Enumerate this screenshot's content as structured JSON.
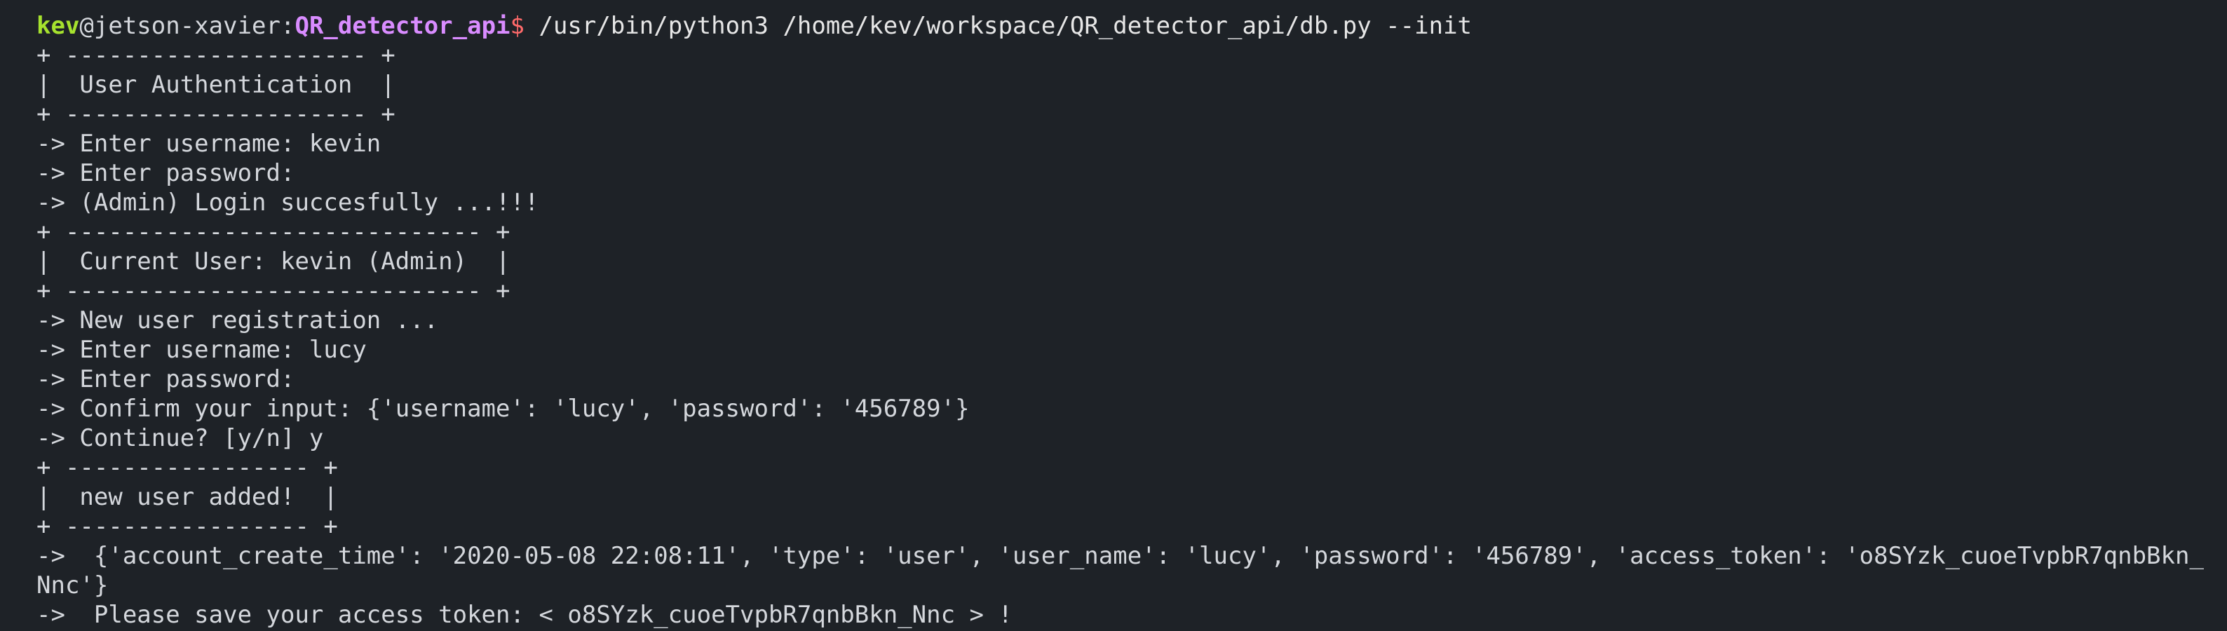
{
  "prompt": {
    "user": "kev",
    "host": "@jetson-xavier:",
    "cwd": "QR_detector_api",
    "sign": "$",
    "command": " /usr/bin/python3 /home/kev/workspace/QR_detector_api/db.py --init"
  },
  "lines": [
    "+ --------------------- +",
    "|  User Authentication  |",
    "+ --------------------- +",
    "-> Enter username: kevin",
    "-> Enter password:",
    "-> (Admin) Login succesfully ...!!!",
    "+ ----------------------------- +",
    "|  Current User: kevin (Admin)  |",
    "+ ----------------------------- +",
    "-> New user registration ...",
    "-> Enter username: lucy",
    "-> Enter password:",
    "-> Confirm your input: {'username': 'lucy', 'password': '456789'}",
    "-> Continue? [y/n] y",
    "+ ----------------- +",
    "|  new user added!  |",
    "+ ----------------- +",
    "->  {'account_create_time': '2020-05-08 22:08:11', 'type': 'user', 'user_name': 'lucy', 'password': '456789', 'access_token': 'o8SYzk_cuoeTvpbR7qnbBkn_",
    "Nnc'}",
    "->  Please save your access token: < o8SYzk_cuoeTvpbR7qnbBkn_Nnc > !"
  ],
  "colors": {
    "background": "#1e2227",
    "text": "#d4d7dc",
    "user": "#a6e22e",
    "cwd": "#d98cff",
    "prompt_sign": "#ff6a6a"
  }
}
